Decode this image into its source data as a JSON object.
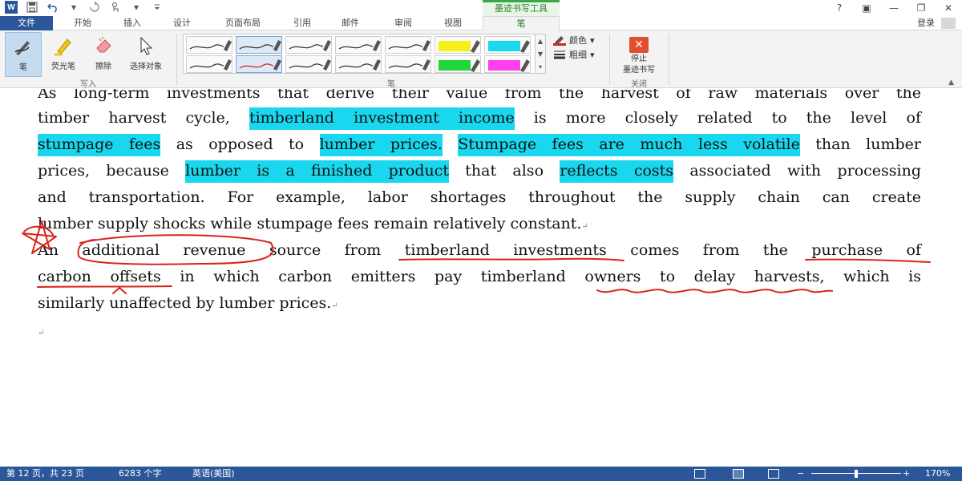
{
  "qat": {
    "word_logo": "W",
    "save_icon": "save-icon",
    "undo_icon": "undo-icon",
    "redo_icon": "redo-icon",
    "touch_icon": "touch-mode-icon",
    "customize_icon": "customize-qat-icon"
  },
  "context_tab_group": "墨迹书写工具",
  "window": {
    "help": "?",
    "ribbon_display": "▣",
    "minimize": "—",
    "restore": "❐",
    "close": "✕"
  },
  "tabs": [
    {
      "label": "文件"
    },
    {
      "label": "开始"
    },
    {
      "label": "插入"
    },
    {
      "label": "设计"
    },
    {
      "label": "页面布局"
    },
    {
      "label": "引用"
    },
    {
      "label": "邮件"
    },
    {
      "label": "审阅"
    },
    {
      "label": "视图"
    },
    {
      "label": "笔"
    }
  ],
  "login_label": "登录",
  "ribbon": {
    "write_group": {
      "label": "写入",
      "tools": [
        {
          "label": "笔"
        },
        {
          "label": "荧光笔"
        },
        {
          "label": "擦除"
        },
        {
          "label": "选择对象"
        }
      ]
    },
    "pens_group": {
      "label": "笔",
      "color_label": "颜色",
      "thickness_label": "粗细",
      "pen_colors_row1": [
        "#333333",
        "#333333",
        "#333333",
        "#333333",
        "#333333",
        "#f7ef1a",
        "#1ad9ee"
      ],
      "pen_colors_row2": [
        "#333333",
        "#c8281e",
        "#333333",
        "#333333",
        "#333333",
        "#22d53a",
        "#ff3ff0"
      ]
    },
    "close_group": {
      "label": "关闭",
      "stop_line1": "停止",
      "stop_line2": "墨迹书写"
    }
  },
  "document": {
    "lines": [
      {
        "segments": [
          {
            "t": "As long-term investments that derive their value from the harvest of raw materials over the",
            "h": false
          }
        ]
      },
      {
        "segments": [
          {
            "t": "timber harvest cycle, ",
            "h": false
          },
          {
            "t": "timberland investment income",
            "h": true
          },
          {
            "t": " is more closely related to the level of",
            "h": false
          }
        ]
      },
      {
        "segments": [
          {
            "t": "stumpage fees",
            "h": true
          },
          {
            "t": " as opposed to ",
            "h": false
          },
          {
            "t": "lumber prices.",
            "h": true
          },
          {
            "t": " ",
            "h": false
          },
          {
            "t": "Stumpage fees are much less volatile",
            "h": true
          },
          {
            "t": " than lumber",
            "h": false
          }
        ]
      },
      {
        "segments": [
          {
            "t": "prices, because ",
            "h": false
          },
          {
            "t": "lumber is a finished product",
            "h": true
          },
          {
            "t": " that also ",
            "h": false
          },
          {
            "t": "reflects costs",
            "h": true
          },
          {
            "t": " associated with processing",
            "h": false
          }
        ]
      },
      {
        "segments": [
          {
            "t": "and transportation. For example, labor shortages throughout the supply chain can create",
            "h": false
          }
        ]
      },
      {
        "segments": [
          {
            "t": "lumber supply shocks while stumpage fees remain relatively constant.",
            "h": false
          }
        ],
        "mark": "↵"
      },
      {
        "segments": [
          {
            "t": "An additional revenue source from timberland investments comes from the purchase of",
            "h": false
          }
        ]
      },
      {
        "segments": [
          {
            "t": "carbon offsets in which carbon emitters pay timberland owners to delay harvests, which is",
            "h": false
          }
        ]
      },
      {
        "segments": [
          {
            "t": "similarly unaffected by lumber prices.",
            "h": false
          }
        ],
        "mark": "↵"
      },
      {
        "segments": [
          {
            "t": "",
            "h": false
          }
        ],
        "mark": "↵"
      }
    ]
  },
  "status": {
    "page": "第 12 页，共 23 页",
    "words": "6283 个字",
    "language": "英语(美国)",
    "zoom_minus": "−",
    "zoom_plus": "+",
    "zoom": "170%",
    "zoom_level": 0.5
  }
}
